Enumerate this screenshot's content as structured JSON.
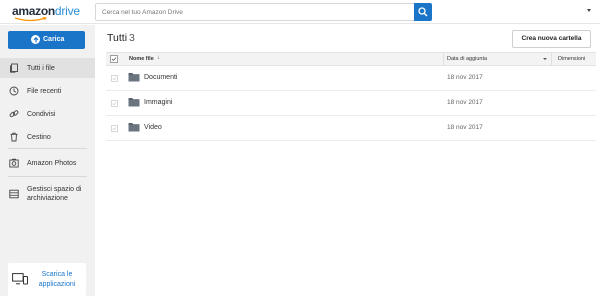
{
  "header": {
    "logo_word1": "amazon",
    "logo_word2": "drive",
    "search_placeholder": "Cerca nel tuo Amazon Drive"
  },
  "sidebar": {
    "upload_label": "Carica",
    "items": [
      {
        "label": "Tutti i file",
        "icon": "files-icon"
      },
      {
        "label": "File recenti",
        "icon": "clock-icon"
      },
      {
        "label": "Condivisi",
        "icon": "link-icon"
      },
      {
        "label": "Cestino",
        "icon": "trash-icon"
      },
      {
        "label": "Amazon Photos",
        "icon": "photos-icon"
      },
      {
        "label": "Gestisci spazio di archiviazione",
        "icon": "storage-icon"
      }
    ],
    "app_label": "Scarica le applicazioni"
  },
  "main": {
    "title": "Tutti",
    "count": "3",
    "new_folder_label": "Crea nuova cartella",
    "columns": {
      "name": "Nome file",
      "date": "Data di aggiunta",
      "size": "Dimensioni"
    },
    "rows": [
      {
        "name": "Documenti",
        "date": "18 nov 2017",
        "size": ""
      },
      {
        "name": "Immagini",
        "date": "18 nov 2017",
        "size": ""
      },
      {
        "name": "Video",
        "date": "18 nov 2017",
        "size": ""
      }
    ]
  },
  "colors": {
    "accent": "#1a75c9",
    "sidebar_bg": "#f1f1f1",
    "folder": "#5a6470"
  }
}
